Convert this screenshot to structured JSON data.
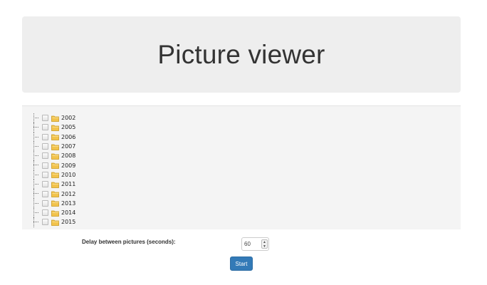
{
  "header": {
    "title": "Picture viewer"
  },
  "tree": {
    "items": [
      {
        "label": "2002"
      },
      {
        "label": "2005"
      },
      {
        "label": "2006"
      },
      {
        "label": "2007"
      },
      {
        "label": "2008"
      },
      {
        "label": "2009"
      },
      {
        "label": "2010"
      },
      {
        "label": "2011"
      },
      {
        "label": "2012"
      },
      {
        "label": "2013"
      },
      {
        "label": "2014"
      },
      {
        "label": "2015"
      }
    ]
  },
  "settings": {
    "delay_label": "Delay between pictures (seconds):",
    "delay_value": "60"
  },
  "actions": {
    "start_label": "Start"
  },
  "colors": {
    "primary": "#337ab7",
    "jumbotron_bg": "#eeeeee",
    "panel_bg": "#f4f4f4"
  }
}
